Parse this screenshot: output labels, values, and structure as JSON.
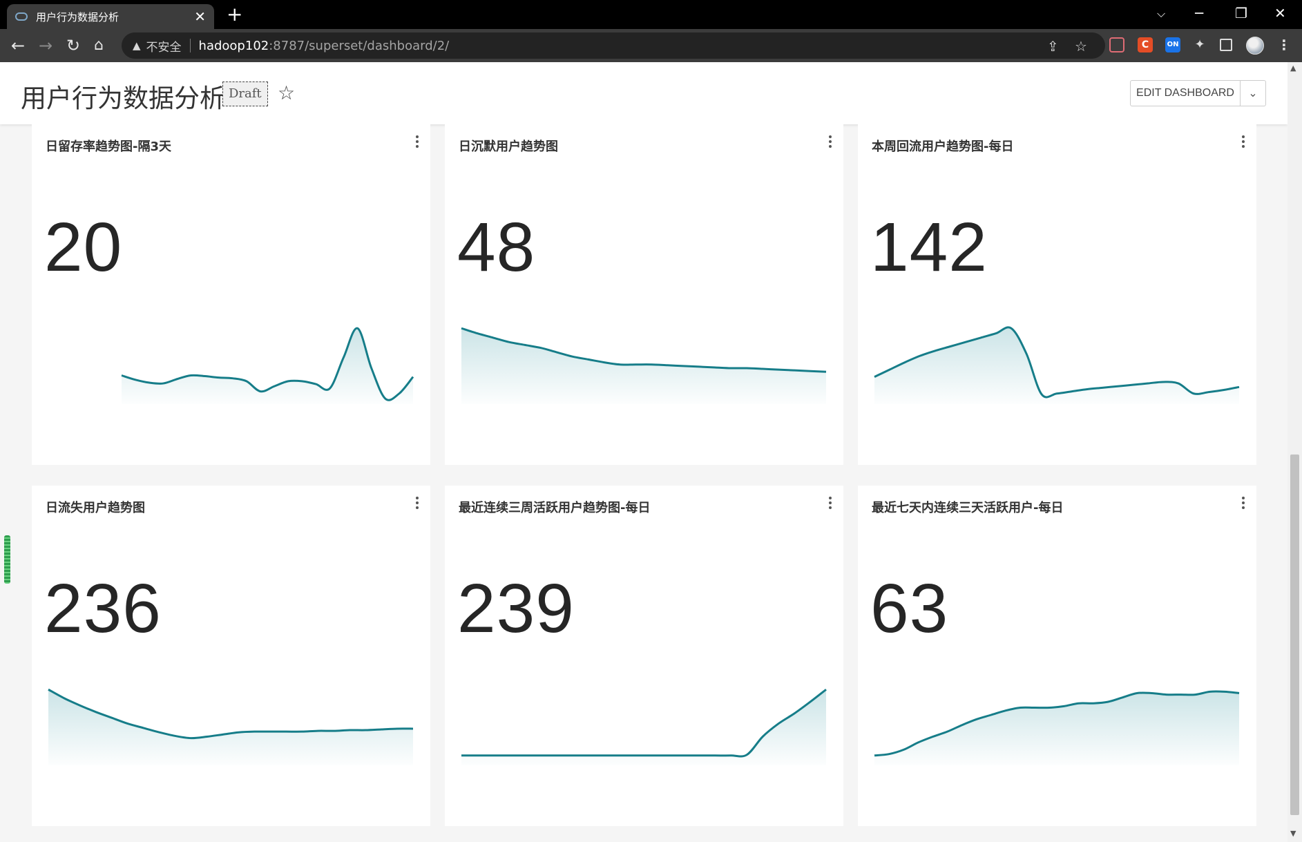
{
  "browser": {
    "tab_title": "用户行为数据分析",
    "new_tab": "+",
    "insecure_label": "不安全",
    "url_host": "hadoop102",
    "url_path": ":8787/superset/dashboard/2/",
    "extensions": [
      {
        "name": "c-extension",
        "label": "C",
        "color": "#e44d26"
      },
      {
        "name": "on-extension",
        "label": "ON",
        "color": "#1a73e8"
      }
    ]
  },
  "header": {
    "title": "用户行为数据分析",
    "badge": "Draft",
    "edit_label": "EDIT DASHBOARD"
  },
  "theme": {
    "sparkline_stroke": "#167d89",
    "sparkline_fill": "#c9e3e6"
  },
  "cards": [
    {
      "title": "日留存率趋势图-隔3天",
      "value": "20",
      "sparkline": [
        30,
        24,
        20,
        19,
        25,
        30,
        29,
        27,
        26,
        22,
        8,
        15,
        22,
        22,
        18,
        12,
        55,
        95,
        40,
        -2,
        5,
        28
      ]
    },
    {
      "title": "日沉默用户趋势图",
      "value": "48",
      "sparkline": [
        95,
        88,
        82,
        76,
        72,
        68,
        62,
        56,
        52,
        48,
        45,
        45,
        45,
        44,
        43,
        42,
        41,
        40,
        40,
        39,
        38,
        37,
        36,
        35
      ]
    },
    {
      "title": "本周回流用户趋势图-每日",
      "value": "142",
      "sparkline": [
        28,
        38,
        48,
        57,
        64,
        70,
        76,
        82,
        88,
        95,
        60,
        4,
        5,
        8,
        11,
        13,
        15,
        17,
        19,
        21,
        19,
        5,
        7,
        10,
        14
      ]
    },
    {
      "title": "日流失用户趋势图",
      "value": "236",
      "sparkline": [
        95,
        83,
        73,
        64,
        56,
        48,
        42,
        36,
        31,
        28,
        30,
        33,
        36,
        37,
        37,
        37,
        37,
        38,
        38,
        39,
        39,
        40,
        41,
        41
      ]
    },
    {
      "title": "最近连续三周活跃用户趋势图-每日",
      "value": "239",
      "sparkline": [
        4,
        4,
        4,
        4,
        4,
        4,
        4,
        4,
        4,
        4,
        4,
        4,
        4,
        4,
        4,
        4,
        4,
        4,
        5,
        30,
        48,
        62,
        78,
        95
      ]
    },
    {
      "title": "最近七天内连续三天活跃用户-每日",
      "value": "63",
      "sparkline": [
        4,
        6,
        12,
        22,
        30,
        37,
        46,
        54,
        60,
        66,
        70,
        70,
        70,
        72,
        76,
        76,
        78,
        84,
        90,
        90,
        88,
        88,
        88,
        92,
        92,
        90
      ]
    }
  ]
}
